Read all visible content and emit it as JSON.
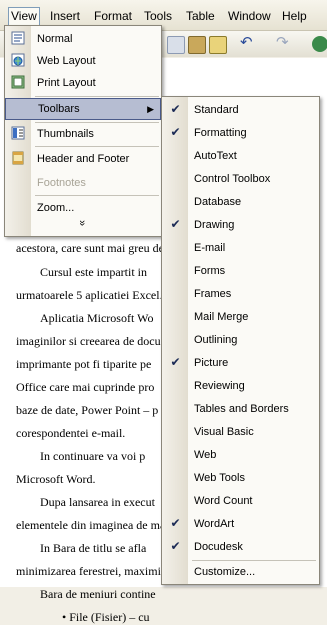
{
  "menubar": {
    "items": [
      "View",
      "Insert",
      "Format",
      "Tools",
      "Table",
      "Window",
      "Help"
    ]
  },
  "view_menu": {
    "items": [
      {
        "label": "Normal",
        "icon": "normal-view-icon"
      },
      {
        "label": "Web Layout",
        "icon": "web-layout-icon"
      },
      {
        "label": "Print Layout",
        "icon": "print-layout-icon"
      },
      {
        "label": "Toolbars",
        "icon": "",
        "submenu": true
      },
      {
        "label": "Thumbnails",
        "icon": "thumbnails-icon"
      },
      {
        "label": "Header and Footer",
        "icon": "header-footer-icon"
      },
      {
        "label": "Footnotes",
        "icon": "",
        "disabled": true
      },
      {
        "label": "Zoom...",
        "icon": ""
      }
    ],
    "expand": "»"
  },
  "toolbars_menu": {
    "items": [
      {
        "label": "Standard",
        "checked": true
      },
      {
        "label": "Formatting",
        "checked": true
      },
      {
        "label": "AutoText",
        "checked": false
      },
      {
        "label": "Control Toolbox",
        "checked": false
      },
      {
        "label": "Database",
        "checked": false
      },
      {
        "label": "Drawing",
        "checked": true
      },
      {
        "label": "E-mail",
        "checked": false
      },
      {
        "label": "Forms",
        "checked": false
      },
      {
        "label": "Frames",
        "checked": false
      },
      {
        "label": "Mail Merge",
        "checked": false
      },
      {
        "label": "Outlining",
        "checked": false
      },
      {
        "label": "Picture",
        "checked": true
      },
      {
        "label": "Reviewing",
        "checked": false
      },
      {
        "label": "Tables and Borders",
        "checked": false
      },
      {
        "label": "Visual Basic",
        "checked": false
      },
      {
        "label": "Web",
        "checked": false
      },
      {
        "label": "Web Tools",
        "checked": false
      },
      {
        "label": "Word Count",
        "checked": false
      },
      {
        "label": "WordArt",
        "checked": true
      },
      {
        "label": "Docudesk",
        "checked": true
      },
      {
        "label": "Customize...",
        "checked": false
      }
    ]
  },
  "document": {
    "lines": [
      "acestora, care sunt mai greu de",
      "Cursul este impartit in",
      "urmatoarele 5 aplicatiei Excel.",
      "Aplicatia Microsoft Wo",
      "imaginilor si creearea de docu",
      "imprimante pot fi tiparite pe",
      "Office care mai cuprinde pro",
      "baze de date, Power Point – p",
      "corespondentei e-mail.",
      "In continuare va voi p",
      "Microsoft Word.",
      "Dupa lansarea in execut",
      "elementele din imaginea de ma",
      "In Bara de titlu se afla",
      "minimizarea ferestrei, maximiz",
      "Bara de meniuri contine",
      "• File (Fisier) – cu"
    ]
  }
}
